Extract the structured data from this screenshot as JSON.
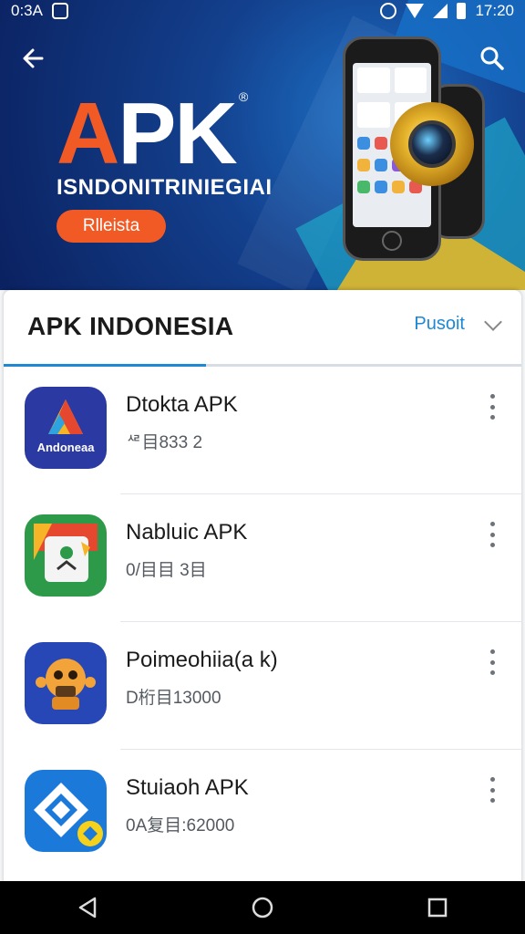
{
  "status_bar": {
    "left_time": "0:3A",
    "right_time": "17:20",
    "icons": [
      "app-notification-icon",
      "alarm-icon",
      "wifi-icon",
      "signal-icon",
      "battery-icon"
    ]
  },
  "hero": {
    "title_accent": "A",
    "title_rest": "PK",
    "registered": "®",
    "subtitle": "ISNDONITRINIEGIAI",
    "cta_label": "Rlleista",
    "colors": {
      "accent": "#f15a24",
      "background": "#13408d"
    }
  },
  "list_header": {
    "title": "APK INDONESIA",
    "filter_label": "Pusoit"
  },
  "apps": [
    {
      "name": "Dtokta APK",
      "meta": "ᄰ目833 2",
      "icon": "triangle-logo-icon",
      "icon_label": "Andoneaa"
    },
    {
      "name": "Nabluic APK",
      "meta": "0/目目 3目",
      "icon": "chrome-like-icon",
      "icon_label": ""
    },
    {
      "name": "Poimeohiia(a k)",
      "meta": "D桁目13000",
      "icon": "robot-icon",
      "icon_label": ""
    },
    {
      "name": "Stuiaoh APK",
      "meta": "0A复目:62000",
      "icon": "diamond-logo-icon",
      "icon_label": ""
    }
  ],
  "nav": [
    "back-nav-icon",
    "home-nav-icon",
    "recents-nav-icon"
  ]
}
